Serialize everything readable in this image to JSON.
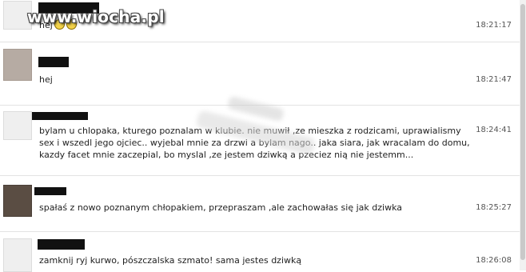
{
  "watermark": "www.wiocha.pl",
  "messages": [
    {
      "text": "hej",
      "time": "18:21:17",
      "emoji_icons": [
        "smiley-icon",
        "smiley-icon"
      ]
    },
    {
      "text": "hej",
      "time": "18:21:47"
    },
    {
      "text": "bylam u chlopaka, kturego poznalam w klubie. nie muwił ,ze mieszka z rodzicami, uprawialismy sex i wszedl jego ojciec.. wyjebal mnie za drzwi a bylam nago.. jaka siara, jak wracalam do domu, kazdy facet mnie zaczepial, bo myslal ,ze jestem dziwką a pzeciez nią nie jestemm...",
      "time": "18:24:41"
    },
    {
      "text": "spałaś z nowo poznanym chłopakiem, przepraszam ,ale zachowałas się jak dziwka",
      "time": "18:25:27"
    },
    {
      "text": "zamknij ryj kurwo, pószczalska szmato! sama jestes dziwką",
      "time": "18:26:08"
    }
  ],
  "colors": {
    "name_redaction": "#111111",
    "divider": "#e3e3e3",
    "time_text": "#555555"
  }
}
